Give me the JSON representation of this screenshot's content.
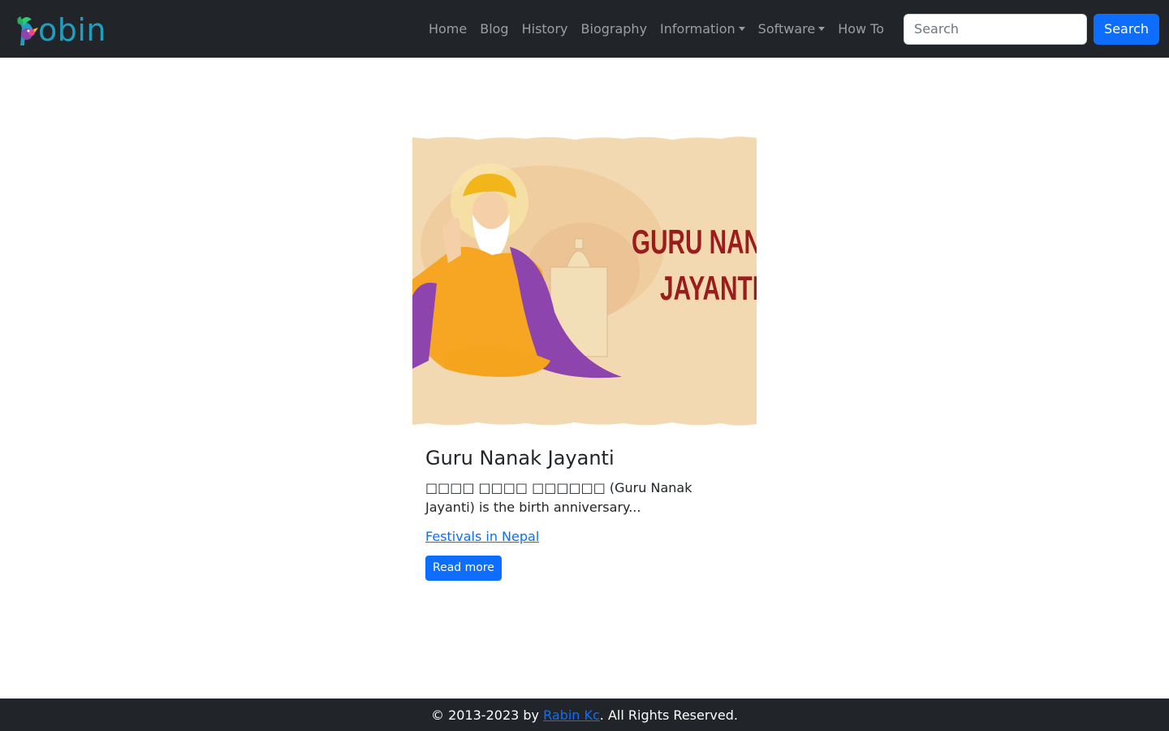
{
  "brand": {
    "text": "obin",
    "logo_icon": "bird-logo-icon",
    "color": "#1e9fbf"
  },
  "nav": {
    "items": [
      {
        "label": "Home"
      },
      {
        "label": "Blog"
      },
      {
        "label": "History"
      },
      {
        "label": "Biography"
      },
      {
        "label": "Information",
        "dropdown": true
      },
      {
        "label": "Software",
        "dropdown": true
      },
      {
        "label": "How To"
      }
    ]
  },
  "search": {
    "placeholder": "Search",
    "button_label": "Search"
  },
  "post": {
    "image_text_line1": "GURU NAN",
    "image_text_line2": "JAYANTI",
    "title": "Guru Nanak Jayanti",
    "excerpt": "□□□□ □□□□ □□□□□□ (Guru Nanak Jayanti) is the birth anniversary...",
    "category": "Festivals in Nepal",
    "read_more_label": "Read more"
  },
  "footer": {
    "prefix": "© 2013-2023 by ",
    "author": "Rabin Kc",
    "suffix": ". All Rights Reserved."
  },
  "colors": {
    "navbar_bg": "#212529",
    "primary": "#0d6efd",
    "image_bg": "#f3d9b1",
    "image_title": "#9b1c1c"
  }
}
